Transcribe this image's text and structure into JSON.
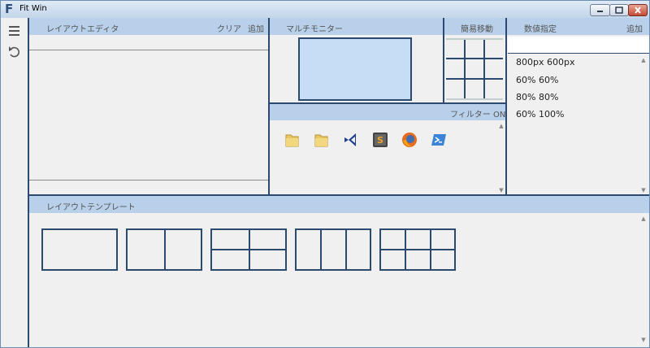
{
  "titlebar": {
    "logo": "F",
    "title": "Fit Win"
  },
  "layout_editor": {
    "title": "レイアウトエディタ",
    "clear_label": "クリア",
    "add_label": "追加"
  },
  "multi_monitor": {
    "title": "マルチモニター"
  },
  "quick_move": {
    "title": "簡易移動"
  },
  "numeric": {
    "title": "数値指定",
    "add_label": "追加",
    "input_value": "",
    "items": [
      "800px 600px",
      "60% 60%",
      "80% 80%",
      "60% 100%"
    ]
  },
  "filter": {
    "label": "フィルター ON"
  },
  "apps": [
    "folder-icon",
    "folder-icon",
    "visual-studio-icon",
    "sublime-text-icon",
    "firefox-icon",
    "powershell-icon"
  ],
  "templates": {
    "title": "レイアウトテンプレート"
  },
  "colors": {
    "accent": "#2c4a6f",
    "header": "#b8d0ea",
    "monitor": "#c7dcf5",
    "background": "#f0f0f0"
  }
}
